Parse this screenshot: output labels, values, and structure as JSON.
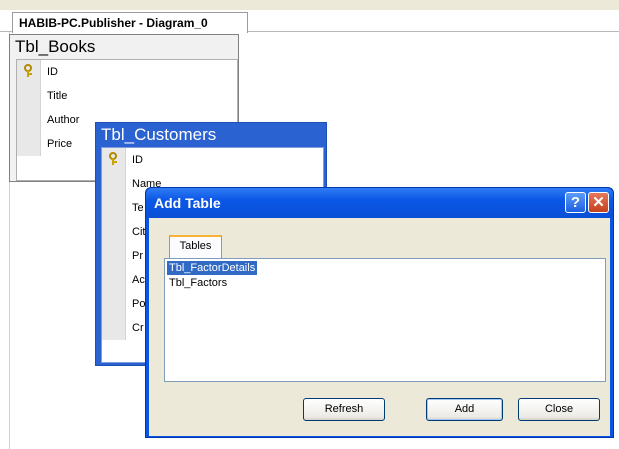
{
  "document_tab": {
    "title": "HABIB-PC.Publisher - Diagram_0"
  },
  "tables": {
    "books": {
      "title": "Tbl_Books",
      "columns": [
        "ID",
        "Title",
        "Author",
        "Price"
      ],
      "key_column": "ID"
    },
    "customers": {
      "title": "Tbl_Customers",
      "columns": [
        "ID",
        "Name",
        "Te",
        "Cit",
        "Pr",
        "Ac",
        "Po",
        "Cr"
      ],
      "key_column": "ID"
    }
  },
  "dialog": {
    "title": "Add Table",
    "help_symbol": "?",
    "close_symbol": "✕",
    "tab_label": "Tables",
    "list_items": [
      "Tbl_FactorDetails",
      "Tbl_Factors"
    ],
    "selected_item": "Tbl_FactorDetails",
    "buttons": {
      "refresh": "Refresh",
      "add": "Add",
      "close": "Close"
    }
  },
  "colors": {
    "xp_title_blue": "#0b57e6",
    "selection_blue": "#316ac5",
    "dialog_face": "#ece9d8",
    "close_red": "#c5401d"
  },
  "icons": {
    "primary_key": "key-icon"
  }
}
